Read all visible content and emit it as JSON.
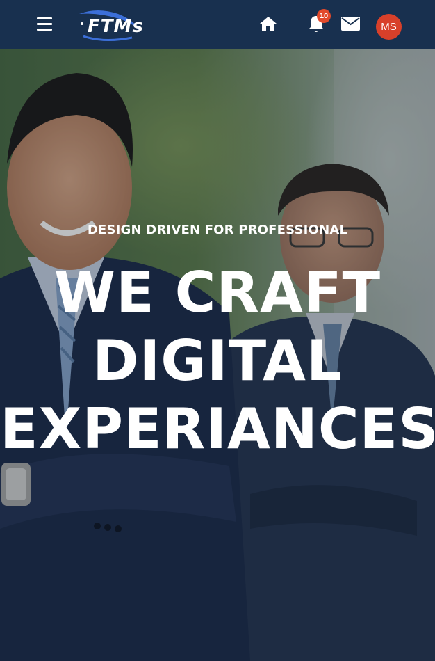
{
  "header": {
    "menu_icon": "hamburger-menu-icon",
    "logo_text": "FTMs",
    "home_icon": "home-icon",
    "notifications": {
      "icon": "bell-icon",
      "count": "10"
    },
    "mail_icon": "envelope-icon",
    "user_initials": "MS"
  },
  "hero": {
    "eyebrow": "DESIGN DRIVEN FOR PROFESSIONAL",
    "headline": [
      "WE CRAFT",
      "DIGITAL",
      "EXPERIANCES"
    ]
  },
  "colors": {
    "topbar": "#18304f",
    "badge": "#e24a2b",
    "avatar": "#d8402a",
    "text": "#ffffff"
  }
}
